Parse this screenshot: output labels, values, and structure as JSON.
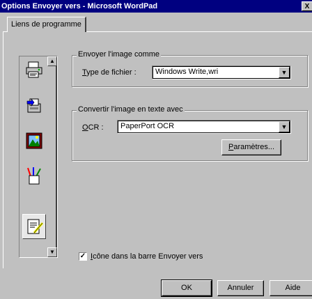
{
  "window": {
    "title": "Options Envoyer vers - Microsoft WordPad",
    "close_label": "X"
  },
  "tabs": [
    {
      "label": "Liens de programme"
    }
  ],
  "icon_list": {
    "items": [
      "printer-icon",
      "fax-icon",
      "image-frame-icon",
      "pencil-cup-icon",
      "document-pencil-icon"
    ]
  },
  "send_image": {
    "legend": "Envoyer l'image comme",
    "filetype_label_u": "T",
    "filetype_label_rest": "ype de fichier :",
    "filetype_value": "Windows Write,wri"
  },
  "ocr_group": {
    "legend": "Convertir l'image en texte avec",
    "ocr_label_u": "O",
    "ocr_label_rest": "CR :",
    "ocr_value": "PaperPort OCR",
    "params_u": "P",
    "params_rest": "aramètres..."
  },
  "checkbox": {
    "mark": "✓",
    "label_u": "I",
    "label_rest": "cône dans la barre Envoyer vers"
  },
  "buttons": {
    "ok": "OK",
    "cancel": "Annuler",
    "help": "Aide"
  },
  "dropdown_glyph": "▼"
}
